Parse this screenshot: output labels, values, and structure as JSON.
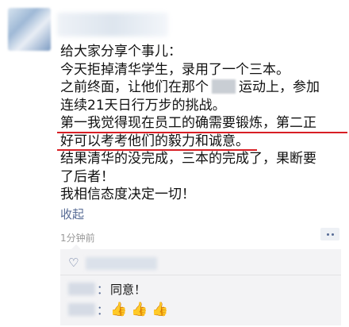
{
  "post": {
    "lines": [
      "给大家分享个事儿：",
      "今天拒掉清华学生，录用了一个三本。",
      "之前终面，让他们在那个",
      "运动上，参加",
      "连续21天日行万步的挑战。",
      "第一我觉得现在员工的确需要锻炼，第二正",
      "好可以考考他们的毅力和诚意。",
      "结果清华的没完成，三本的完成了，果断要",
      "了后者！",
      "我相信态度决定一切！"
    ],
    "collapse_label": "收起",
    "timestamp": "1分钟前"
  },
  "comments": [
    {
      "separator": "：",
      "text": "同意！"
    },
    {
      "separator": "：",
      "icons": [
        "thumbs-up-icon",
        "thumbs-up-icon",
        "thumbs-up-icon"
      ]
    }
  ],
  "colors": {
    "link": "#576b95",
    "underline": "#d81e24",
    "timestamp": "#999999",
    "comment_bg": "#f3f3f5"
  }
}
